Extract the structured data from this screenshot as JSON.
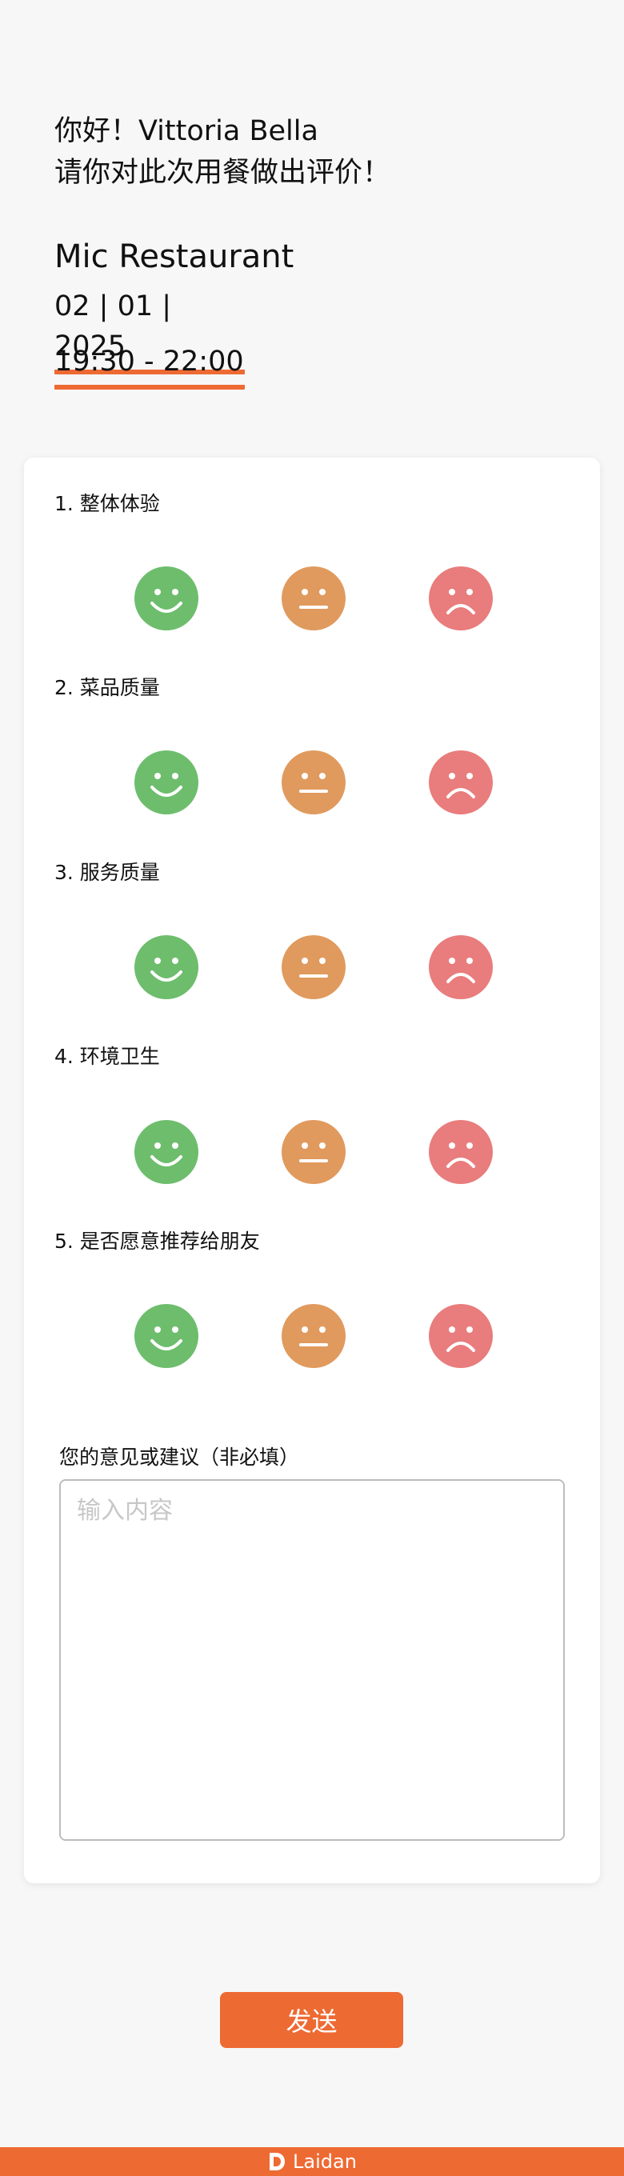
{
  "greeting": {
    "line1": "你好！Vittoria Bella",
    "line2": "请你对此次用餐做出评价！"
  },
  "booking": {
    "restaurant": "Mic Restaurant",
    "date": "02 | 01 | 2025",
    "time": "19:30 - 22:00"
  },
  "questions": [
    {
      "label": "1. 整体体验"
    },
    {
      "label": "2. 菜品质量"
    },
    {
      "label": "3. 服务质量"
    },
    {
      "label": "4. 环境卫生"
    },
    {
      "label": "5. 是否愿意推荐给朋友"
    }
  ],
  "rating_options": [
    "happy-face-icon",
    "neutral-face-icon",
    "sad-face-icon"
  ],
  "colors": {
    "accent": "#ee6a33",
    "happy": "#6dbd6d",
    "neutral": "#e09a5e",
    "sad": "#e97c7c"
  },
  "comment": {
    "label": "您的意见或建议（非必填）",
    "placeholder": "输入内容",
    "value": ""
  },
  "send_label": "发送",
  "footer": {
    "brand": "Laidan"
  }
}
